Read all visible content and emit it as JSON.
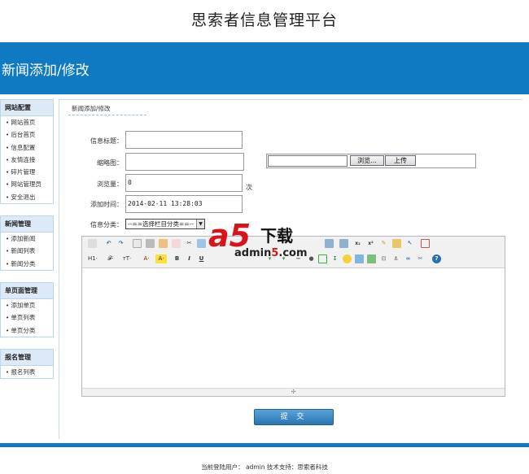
{
  "header": {
    "title": "思索者信息管理平台"
  },
  "banner": {
    "title": "新闻添加/修改"
  },
  "sidebar": {
    "groups": [
      {
        "title": "网站配置",
        "items": [
          "网站首页",
          "后台首页",
          "信息配置",
          "友情连接",
          "碎片管理",
          "网站管理员",
          "安全退出"
        ]
      },
      {
        "title": "新闻管理",
        "items": [
          "添加新闻",
          "新闻列表",
          "新闻分类"
        ]
      },
      {
        "title": "单页面管理",
        "items": [
          "添加单页",
          "单页列表",
          "单页分类"
        ]
      },
      {
        "title": "报名管理",
        "items": [
          "报名列表"
        ]
      }
    ]
  },
  "form": {
    "breadcrumb": "新闻添加/修改",
    "title_label": "信息标题：",
    "title_value": "",
    "thumb_label": "缩略图：",
    "thumb_value": "",
    "browse_label": "浏览...",
    "upload_label": "上传",
    "views_label": "浏览量：",
    "views_value": "0",
    "views_unit": "次",
    "time_label": "添加时间：",
    "time_value": "2014-02-11 13:28:03",
    "category_label": "信息分类：",
    "category_selected": "--==选择栏目分类==--",
    "submit_label": "提 交"
  },
  "editor": {
    "toolbar_row2": [
      "H1·",
      "𝓕·",
      "тT·",
      "A·",
      "A·",
      "B",
      "I",
      "U"
    ]
  },
  "watermark": {
    "logo": "a5",
    "cn": "下载",
    "url_pre": "admin",
    "url_num": "5",
    "url_post": ".com"
  },
  "footer": {
    "text": "当前登陆用户： admin  技术支持：思索者科技"
  },
  "colors": {
    "brand": "#0f7ac1",
    "menu_header": "#dbeaf6"
  }
}
